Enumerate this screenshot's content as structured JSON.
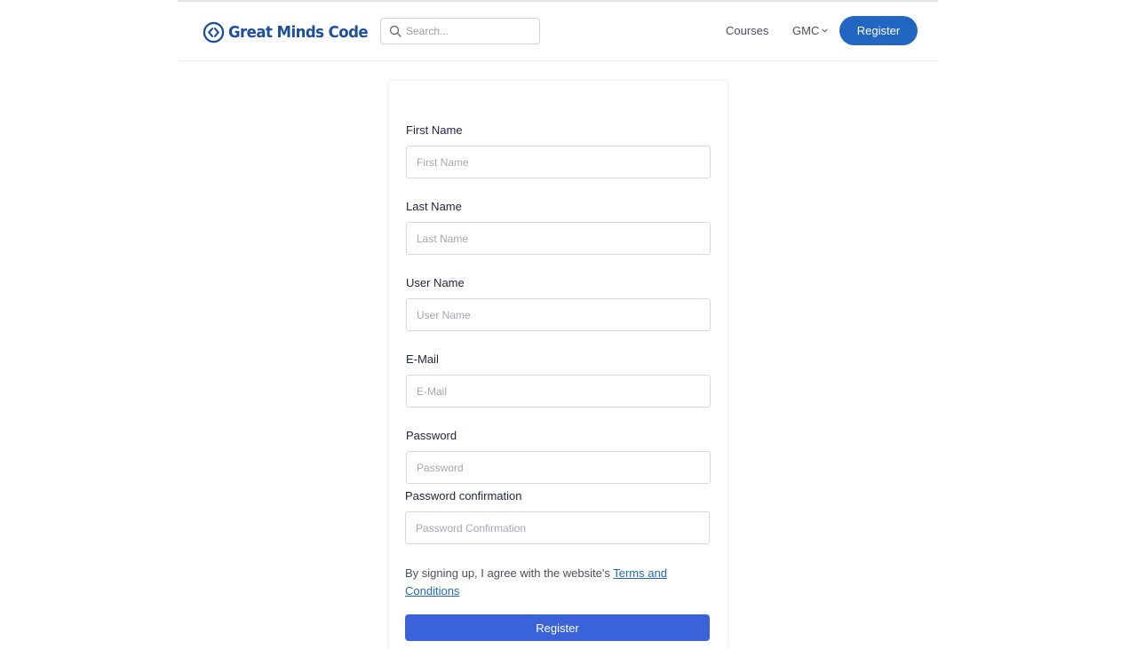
{
  "header": {
    "logo_text": "Great Minds Code",
    "search_placeholder": "Search...",
    "nav": {
      "courses": "Courses",
      "gmc": "GMC"
    },
    "register_button": "Register"
  },
  "form": {
    "fields": [
      {
        "label": "First Name",
        "placeholder": "First Name"
      },
      {
        "label": "Last Name",
        "placeholder": "Last Name"
      },
      {
        "label": "User Name",
        "placeholder": "User Name"
      },
      {
        "label": "E-Mail",
        "placeholder": "E-Mail"
      },
      {
        "label": "Password",
        "placeholder": "Password"
      },
      {
        "label": "Password confirmation",
        "placeholder": "Password Confirmation"
      }
    ],
    "consent_text": "By signing up, I agree with the website's",
    "terms_link": "Terms and Conditions",
    "submit_button": "Register"
  },
  "icons": {
    "logo": "code-brackets-circle-icon",
    "search": "search-icon",
    "dropdown": "chevron-down-icon"
  },
  "colors": {
    "brand": "#1d4f9c",
    "primary_button": "#2167c2",
    "submit_button": "#3a63da",
    "link": "#2167c2"
  }
}
